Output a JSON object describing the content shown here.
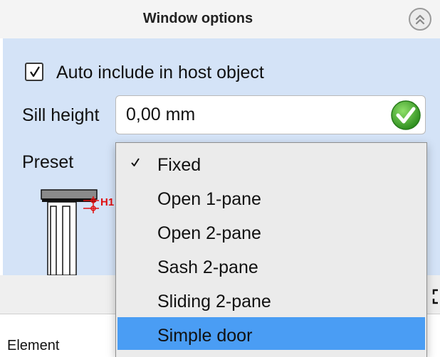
{
  "panel": {
    "title": "Window options",
    "collapse_icon": "chevron-double-up-icon"
  },
  "auto_include": {
    "label": "Auto include in host object",
    "checked": true
  },
  "sill_height": {
    "label": "Sill height",
    "value": "0,00 mm",
    "valid_icon": "green-check-icon"
  },
  "preset": {
    "label": "Preset",
    "options": [
      {
        "label": "Fixed",
        "checked": true
      },
      {
        "label": "Open 1-pane",
        "checked": false
      },
      {
        "label": "Open 2-pane",
        "checked": false
      },
      {
        "label": "Sash 2-pane",
        "checked": false
      },
      {
        "label": "Sliding 2-pane",
        "checked": false
      },
      {
        "label": "Simple door",
        "checked": false,
        "highlighted": true
      }
    ]
  },
  "diagram": {
    "dimension_label": "H1"
  },
  "lower": {
    "element_label": "Element"
  },
  "colors": {
    "panel_bg": "#d4e3f7",
    "highlight": "#4a9df4",
    "dimension_red": "#e01010",
    "check_green": "#3fae2a"
  }
}
